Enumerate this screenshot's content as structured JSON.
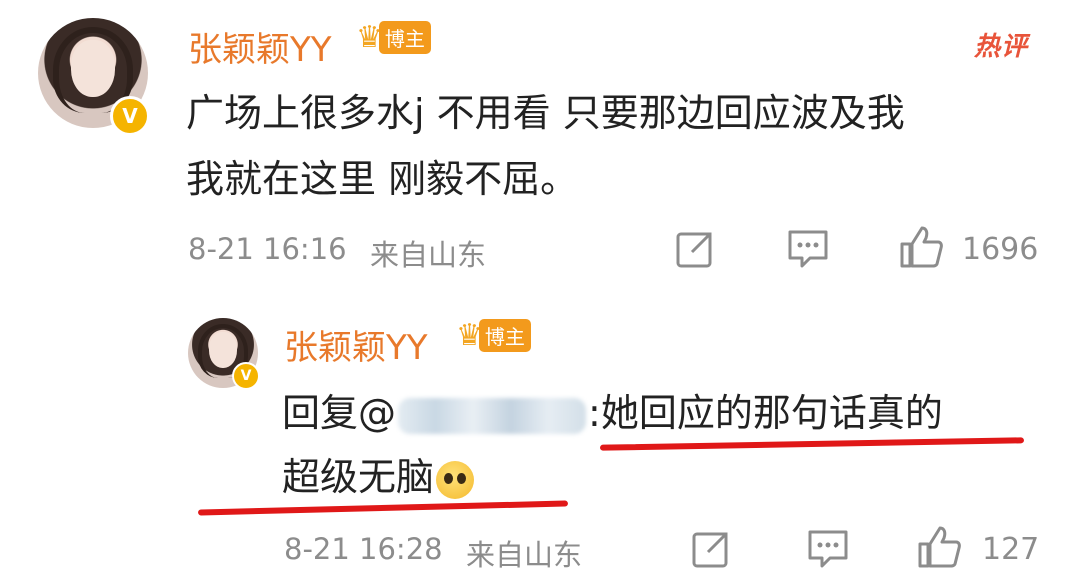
{
  "hot_label": "热评",
  "comment": {
    "username": "张颖颖YY",
    "badge": "博主",
    "text_line1": "广场上很多水j 不用看 只要那边回应波及我",
    "text_line2": "我就在这里 刚毅不屈。",
    "time": "8-21 16:16",
    "location": "来自山东",
    "likes": "1696"
  },
  "reply": {
    "username": "张颖颖YY",
    "badge": "博主",
    "prefix": "回复@",
    "suffix": ":她回应的那句话真的",
    "text_line2": "超级无脑",
    "time": "8-21 16:28",
    "location": "来自山东",
    "likes": "127"
  },
  "icons": {
    "verified": "verified-v-icon",
    "crown": "crown-icon",
    "share": "share-icon",
    "comment": "comment-icon",
    "like": "thumbs-up-icon",
    "emoji": "sad-face-emoji"
  },
  "colors": {
    "username": "#e8792b",
    "badge": "#f39a1c",
    "hot": "#e8543a",
    "meta": "#8c8c8c",
    "underline": "#e01818",
    "verified": "#f5b400"
  }
}
